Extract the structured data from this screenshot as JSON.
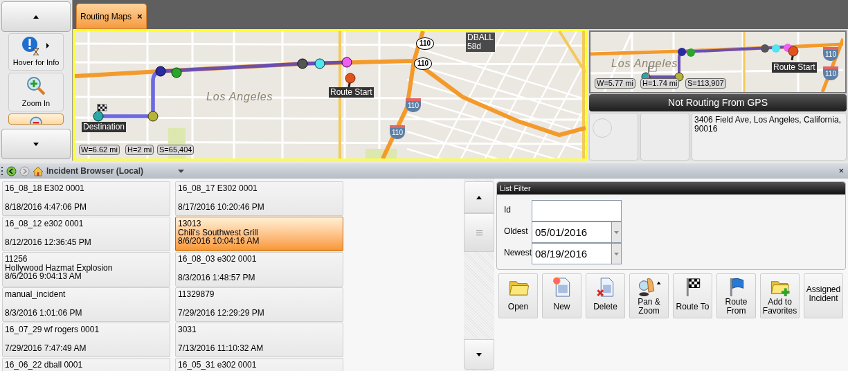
{
  "side_panel": {
    "items": [
      {
        "label": "Hover for Info",
        "kind": "info",
        "selected": false
      },
      {
        "label": "Zoom In",
        "kind": "zoom_in",
        "selected": false
      },
      {
        "kind": "zoom_out",
        "selected": true
      }
    ]
  },
  "tabs": [
    {
      "label": "Routing Maps",
      "close": "×",
      "selected": true
    }
  ],
  "main_map": {
    "place_label": "Los Angeles",
    "markers": [
      {
        "label": "Destination",
        "kind": "destination"
      },
      {
        "label": "Route Start",
        "kind": "start"
      }
    ],
    "callout": [
      "DBALL",
      "58d"
    ],
    "shields": [
      {
        "text": "110",
        "kind": "state"
      },
      {
        "text": "110",
        "kind": "state"
      },
      {
        "text": "110",
        "kind": "interstate"
      },
      {
        "text": "110",
        "kind": "interstate"
      }
    ],
    "scale": [
      "W=6.62 mi",
      "H=2 mi",
      "S=65,404"
    ]
  },
  "mini_map": {
    "place_label": "Los Angeles",
    "markers": [
      {
        "label": "Route Start",
        "kind": "start"
      }
    ],
    "shields": [
      {
        "text": "110",
        "kind": "interstate"
      },
      {
        "text": "110",
        "kind": "interstate"
      }
    ],
    "scale": [
      "W=5.77 mi",
      "H=1.74 mi",
      "S=113,907"
    ]
  },
  "gps_status": "Not Routing From GPS",
  "destination_address": "3406 Field Ave, Los Angeles, California, 90016",
  "browser": {
    "title": "Incident Browser (Local)",
    "close": "×"
  },
  "incidents": [
    {
      "id": "16_08_18 E302 0001",
      "time": "8/18/2016 4:47:06 PM",
      "selected": false
    },
    {
      "id": "16_08_17 E302 0001",
      "time": "8/17/2016 10:20:46 PM",
      "selected": false
    },
    {
      "id": "16_08_12 e302 0001",
      "time": "8/12/2016 12:36:45 PM",
      "selected": false
    },
    {
      "id": "13013",
      "name": "Chili's Southwest Grill",
      "time": "8/6/2016 10:04:16 AM",
      "selected": true
    },
    {
      "id": "11256",
      "name": "Hollywood Hazmat Explosion",
      "time": "8/6/2016 9:04:13 AM",
      "selected": false
    },
    {
      "id": "16_08_03 e302 0001",
      "time": "8/3/2016 1:48:57 PM",
      "selected": false
    },
    {
      "id": "manual_incident",
      "time": "8/3/2016 1:01:06 PM",
      "selected": false
    },
    {
      "id": "11329879",
      "time": "7/29/2016 12:29:29 PM",
      "selected": false
    },
    {
      "id": "16_07_29 wf rogers 0001",
      "time": "7/29/2016 7:47:49 AM",
      "selected": false
    },
    {
      "id": "3031",
      "time": "7/13/2016 11:10:32 AM",
      "selected": false
    },
    {
      "id": "16_06_22 dball 0001",
      "selected": false
    },
    {
      "id": "16_05_31 e302 0001",
      "selected": false
    }
  ],
  "list_filter": {
    "title": "List Filter",
    "fields": [
      {
        "label": "Id",
        "kind": "text"
      },
      {
        "label": "Oldest",
        "kind": "date",
        "value": "05/01/2016"
      },
      {
        "label": "Newest",
        "kind": "date",
        "value": "08/19/2016"
      }
    ]
  },
  "actions": [
    {
      "label": "Open",
      "kind": "open"
    },
    {
      "label": "New",
      "kind": "new"
    },
    {
      "label": "Delete",
      "kind": "delete"
    },
    {
      "label": "Pan & Zoom",
      "kind": "pan_zoom"
    },
    {
      "label": "Route To",
      "kind": "route_to"
    },
    {
      "label": "Route From",
      "kind": "route_from"
    },
    {
      "label": "Add to Favorites",
      "kind": "favorite"
    },
    {
      "label": "Assigned Incident",
      "kind": "assigned"
    }
  ]
}
